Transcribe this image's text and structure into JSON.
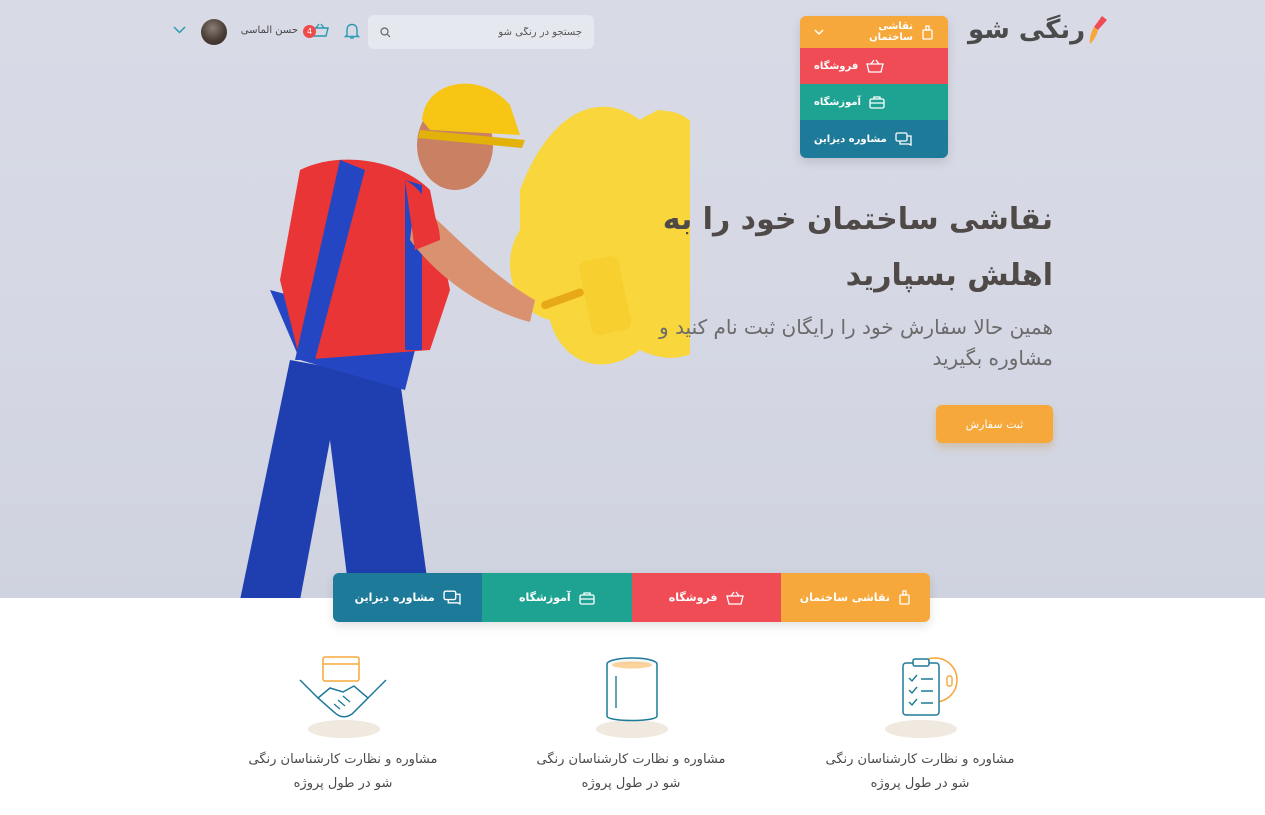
{
  "brand": {
    "logo_text": "رنگی شو"
  },
  "menu": {
    "items": [
      {
        "label": "نقاشی ساختمان",
        "color": "#f6a83b"
      },
      {
        "label": "فروشگاه",
        "color": "#ef4c56"
      },
      {
        "label": "آموزشگاه",
        "color": "#1ea392"
      },
      {
        "label": "مشاوره دیزاین",
        "color": "#1e7a99"
      }
    ]
  },
  "search": {
    "placeholder": "جستجو در رنگی شو"
  },
  "header": {
    "cart_count": "4",
    "user_name": "حسن الماسی"
  },
  "hero": {
    "headline": "نقاشی ساختمان خود را به اهلش بسپارید",
    "subline": "همین حالا سفارش خود را رایگان ثبت نام کنید و مشاوره بگیرید",
    "cta_label": "ثبت سفارش"
  },
  "tabs": [
    {
      "label": "نقاشی ساختمان",
      "color": "#f6a83b"
    },
    {
      "label": "فروشگاه",
      "color": "#ef4c56"
    },
    {
      "label": "آموزشگاه",
      "color": "#1ea392"
    },
    {
      "label": "مشاوره دیزاین",
      "color": "#1e7a99"
    }
  ],
  "features": [
    {
      "text": "مشاوره و نظارت کارشناسان رنگی شو در طول پروژه",
      "icon": "checklist-icon"
    },
    {
      "text": "مشاوره و نظارت کارشناسان رنگی شو در طول پروژه",
      "icon": "paint-bucket-icon"
    },
    {
      "text": "مشاوره و نظارت کارشناسان رنگی شو در طول پروژه",
      "icon": "handshake-icon"
    }
  ]
}
